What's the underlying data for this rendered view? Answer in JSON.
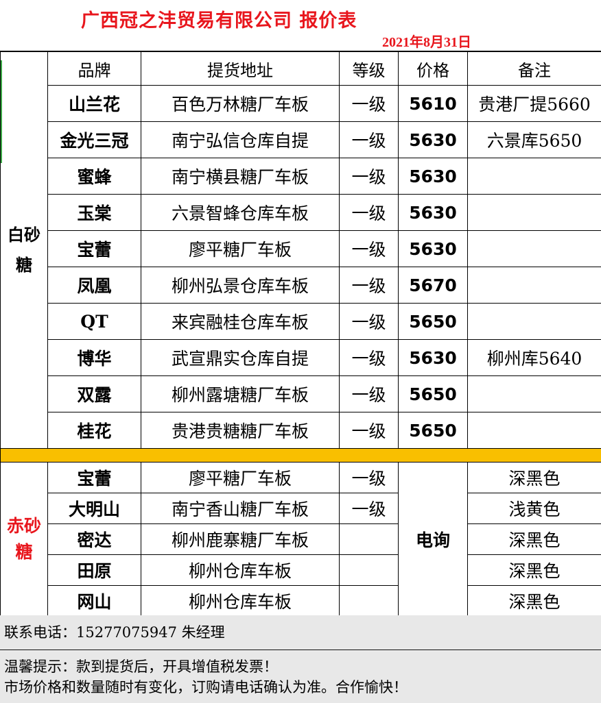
{
  "title": "广西冠之沣贸易有限公司  报价表",
  "date": "2021年8月31日",
  "headers": {
    "brand": "品牌",
    "address": "提货地址",
    "grade": "等级",
    "price": "价格",
    "note": "备注"
  },
  "white_sugar": {
    "category": "白砂糖",
    "rows": [
      {
        "brand": "山兰花",
        "address": "百色万林糖厂车板",
        "grade": "一级",
        "price": "5610",
        "note": "贵港厂提5660"
      },
      {
        "brand": "金光三冠",
        "address": "南宁弘信仓库自提",
        "grade": "一级",
        "price": "5630",
        "note": "六景库5650"
      },
      {
        "brand": "蜜蜂",
        "address": "南宁横县糖厂车板",
        "grade": "一级",
        "price": "5630",
        "note": ""
      },
      {
        "brand": "玉棠",
        "address": "六景智蜂仓库车板",
        "grade": "一级",
        "price": "5630",
        "note": ""
      },
      {
        "brand": "宝蕾",
        "address": "廖平糖厂车板",
        "grade": "一级",
        "price": "5630",
        "note": ""
      },
      {
        "brand": "凤凰",
        "address": "柳州弘景仓库车板",
        "grade": "一级",
        "price": "5670",
        "note": ""
      },
      {
        "brand": "QT",
        "address": "来宾融桂仓库车板",
        "grade": "一级",
        "price": "5650",
        "note": ""
      },
      {
        "brand": "博华",
        "address": "武宣鼎实仓库自提",
        "grade": "一级",
        "price": "5630",
        "note": "柳州库5640"
      },
      {
        "brand": "双露",
        "address": "柳州露塘糖厂车板",
        "grade": "一级",
        "price": "5650",
        "note": ""
      },
      {
        "brand": "桂花",
        "address": "贵港贵糖糖厂车板",
        "grade": "一级",
        "price": "5650",
        "note": ""
      }
    ]
  },
  "red_sugar": {
    "category": "赤砂糖",
    "price_text": "电询",
    "rows": [
      {
        "brand": "宝蕾",
        "address": "廖平糖厂车板",
        "grade": "一级",
        "note": "深黑色"
      },
      {
        "brand": "大明山",
        "address": "南宁香山糖厂车板",
        "grade": "一级",
        "note": "浅黄色"
      },
      {
        "brand": "密达",
        "address": "柳州鹿寨糖厂车板",
        "grade": "",
        "note": "深黑色"
      },
      {
        "brand": "田原",
        "address": "柳州仓库车板",
        "grade": "",
        "note": "深黑色"
      },
      {
        "brand": "网山",
        "address": "柳州仓库车板",
        "grade": "",
        "note": "深黑色"
      }
    ]
  },
  "footer": {
    "contact": "联系电话：15277075947 朱经理",
    "note1": "温馨提示：款到提货后，开具增值税发票！",
    "note2": "市场价格和数量随时有变化，订购请电话确认为准。合作愉快！"
  },
  "colors": {
    "title_red": "#e8161d",
    "band_yellow": "#f9bf00",
    "footer_gray": "#e8e8e8"
  }
}
